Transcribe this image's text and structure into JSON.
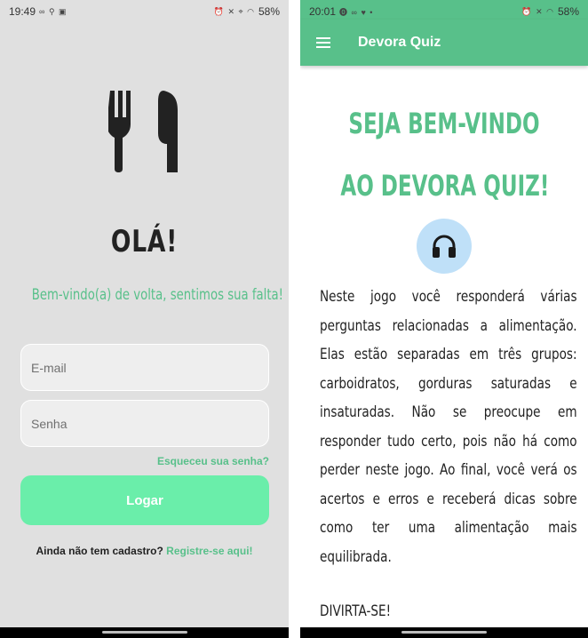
{
  "login_screen": {
    "status_bar": {
      "time": "19:49",
      "notification_icons": "∞ ⚲ ▣",
      "system_icons": "⏰ ✕ ⌖ ◠",
      "battery": "58%"
    },
    "heading": "OLÁ!",
    "subtitle": "Bem-vindo(a) de volta, sentimos sua falta!",
    "email_placeholder": "E-mail",
    "password_placeholder": "Senha",
    "forgot_password": "Esqueceu sua senha?",
    "login_button": "Logar",
    "register_prompt": "Ainda não tem cadastro?",
    "register_link": "Registre-se aqui!"
  },
  "quiz_screen": {
    "status_bar": {
      "time": "20:01",
      "notification_icons": "⓿ ∞ ♥ •",
      "system_icons": "⏰ ✕ ◠",
      "battery": "58%"
    },
    "app_title": "Devora Quiz",
    "headline_line1": "SEJA BEM-VINDO",
    "headline_line2": "AO DEVORA QUIZ!",
    "intro_text": "Neste jogo você responderá várias perguntas relacionadas a alimentação. Elas estão separadas em três grupos: carboidratos, gorduras saturadas e insaturadas. Não se preocupe em responder tudo certo, pois não há como perder neste jogo. Ao final, você verá os acertos e erros e receberá dicas sobre como ter uma alimentação mais equilibrada.",
    "closing_text": "DIVIRTA-SE!"
  },
  "colors": {
    "accent_green": "#58c08a",
    "button_green": "#6aeeaa",
    "audio_button_bg": "#bfe0f8",
    "login_background": "#e0e0e0"
  },
  "icons": [
    "fork-knife-icon",
    "menu-icon",
    "headphones-icon"
  ]
}
